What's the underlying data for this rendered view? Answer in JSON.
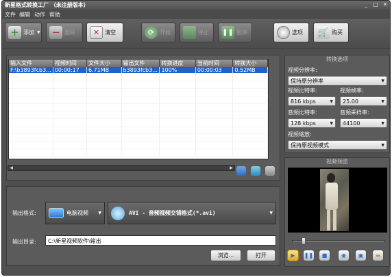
{
  "window": {
    "title": "新星格式转换工厂 （未注册版本）",
    "controls": [
      "_",
      "□",
      "✕"
    ]
  },
  "menu": [
    "文件",
    "编辑",
    "动作",
    "帮助"
  ],
  "toolbar": {
    "add": "添加",
    "delete": "删除",
    "clear": "清空",
    "start": "开始",
    "stop": "停止",
    "pause": "暂停",
    "options": "选项",
    "buy": "购买"
  },
  "file_table": {
    "columns": [
      "输入文件",
      "视频时间",
      "文件大小",
      "输出文件",
      "转换进度",
      "当前时间",
      "转换大小"
    ],
    "rows": [
      [
        "F:\\b3893fcb3...",
        "00:00:17",
        "6.71MB",
        "b3893fcb3...",
        "100%",
        "00:00:03",
        "0.52MB"
      ]
    ]
  },
  "output": {
    "format_label": "输出格式:",
    "device": "电脑视频",
    "format": "AVI - 音频视频交错格式(*.avi)",
    "dir_label": "输出目录:",
    "dir": "C:\\新星视频软件\\输出",
    "browse": "浏览...",
    "open": "打开"
  },
  "settings": {
    "header": "转换选项",
    "resolution_label": "视频分辨率:",
    "resolution": "保持原分辨率",
    "video_bitrate_label": "视频比特率:",
    "video_bitrate": "816 kbps",
    "framerate_label": "视频帧率:",
    "framerate": "25.00",
    "audio_bitrate_label": "音频比特率:",
    "audio_bitrate": "128 kbps",
    "samplerate_label": "音频采样率:",
    "samplerate": "44100",
    "scale_label": "视频缩放:",
    "scale": "保持原视频模式"
  },
  "preview": {
    "header": "视频预览",
    "slider_position": 0.1
  },
  "colors": {
    "window_bg": "#4f4f4f",
    "selection": "#1f63c8"
  }
}
